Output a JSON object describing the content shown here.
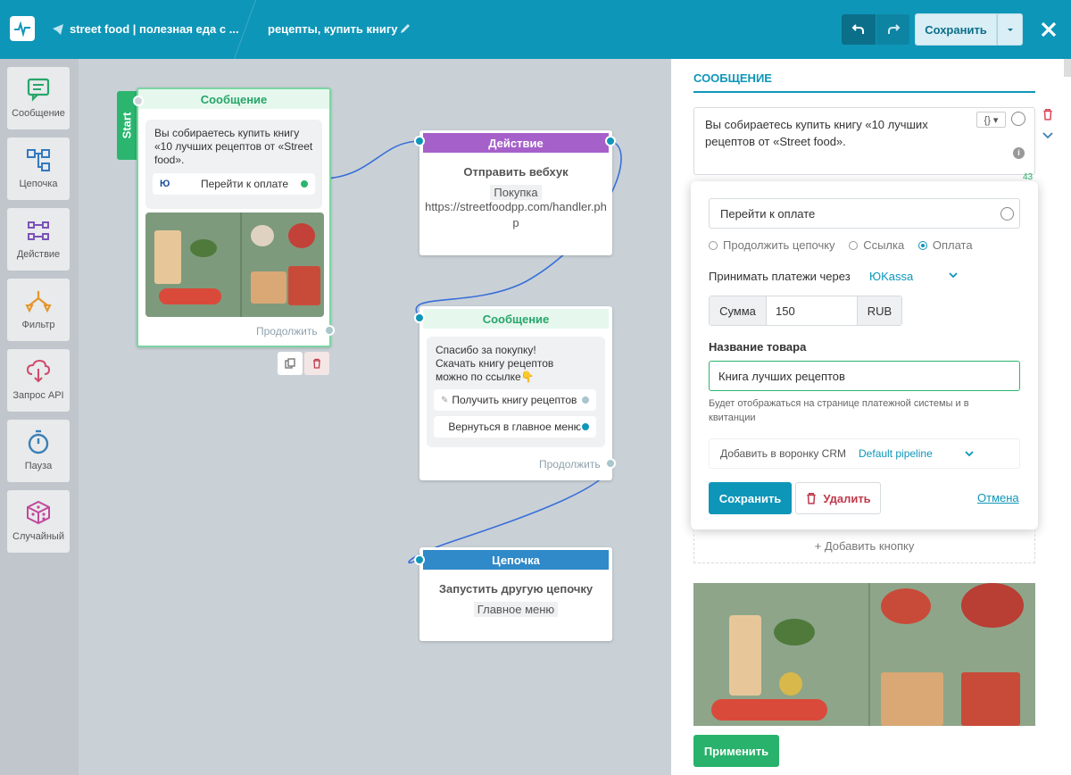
{
  "header": {
    "bot_name": "street food | полезная еда с ...",
    "flow_name": "рецепты, купить книгу",
    "save_label": "Сохранить"
  },
  "sidebar": {
    "items": [
      {
        "label": "Сообщение",
        "icon": "message-icon"
      },
      {
        "label": "Цепочка",
        "icon": "chain-icon"
      },
      {
        "label": "Действие",
        "icon": "action-icon"
      },
      {
        "label": "Фильтр",
        "icon": "filter-icon"
      },
      {
        "label": "Запрос API",
        "icon": "api-request-icon"
      },
      {
        "label": "Пауза",
        "icon": "pause-timer-icon"
      },
      {
        "label": "Случайный",
        "icon": "random-dice-icon"
      }
    ]
  },
  "canvas": {
    "start_label": "Start",
    "node1": {
      "title": "Сообщение",
      "text": "Вы собираетесь купить книгу «10 лучших рецептов от «Street food».",
      "button": "Перейти к оплате",
      "button_badge": "Ю",
      "continue": "Продолжить"
    },
    "node2": {
      "title": "Действие",
      "subtitle": "Отправить вебхук",
      "tag": "Покупка",
      "url": "https://streetfoodpp.com/handler.php"
    },
    "node3": {
      "title": "Сообщение",
      "text": "Спасибо за покупку! Скачать книгу рецептов можно по ссылке👇",
      "button1": "Получить книгу рецептов",
      "button2": "Вернуться в главное меню",
      "continue": "Продолжить"
    },
    "node4": {
      "title": "Цепочка",
      "subtitle": "Запустить другую цепочку",
      "tag": "Главное меню"
    }
  },
  "panel": {
    "section_title": "СООБЩЕНИЕ",
    "message_text": "Вы собираетесь купить книгу «10 лучших рецептов от «Street food».",
    "char_count": "43",
    "button_form": {
      "button_text": "Перейти к оплате",
      "radio_options": [
        "Продолжить цепочку",
        "Ссылка",
        "Оплата"
      ],
      "selected_radio": "Оплата",
      "payments_label": "Принимать платежи через",
      "provider": "ЮKassa",
      "sum_label": "Сумма",
      "sum_value": "150",
      "currency": "RUB",
      "product_label": "Название товара",
      "product_value": "Книга лучших рецептов",
      "product_hint": "Будет отображаться на странице платежной системы и в квитанции",
      "crm_label": "Добавить в воронку CRM",
      "crm_value": "Default pipeline",
      "save": "Сохранить",
      "delete": "Удалить",
      "cancel": "Отмена"
    },
    "add_button": "+ Добавить кнопку",
    "apply": "Применить"
  },
  "colors": {
    "header": "#0e96b8",
    "message_green": "#26b36b",
    "action_purple": "#a660c9",
    "chain_blue": "#3089c9",
    "apply_green": "#28b26b",
    "delete_red": "#c0394b"
  }
}
